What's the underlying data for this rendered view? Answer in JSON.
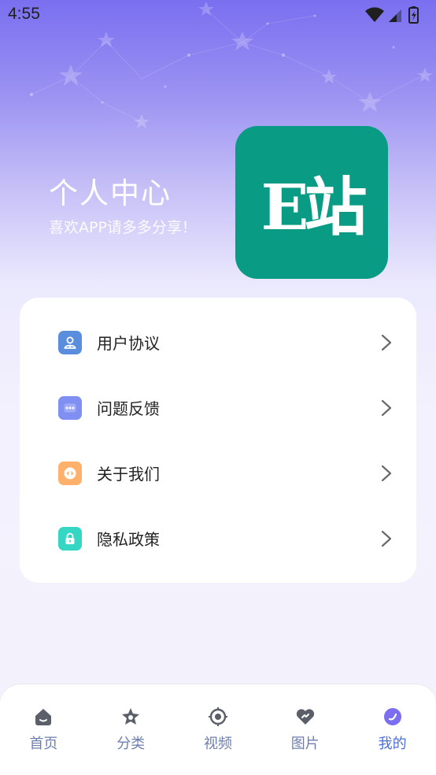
{
  "status_bar": {
    "time": "4:55"
  },
  "header": {
    "title": "个人中心",
    "subtitle": "喜欢APP请多多分享！",
    "logo_text": "E站",
    "logo_color": "#0a9b85"
  },
  "menu": {
    "items": [
      {
        "label": "用户协议",
        "icon": "user-agreement-icon",
        "color": "#5b8ddf"
      },
      {
        "label": "问题反馈",
        "icon": "feedback-chat-icon",
        "color": "#7f8ff2"
      },
      {
        "label": "关于我们",
        "icon": "about-us-icon",
        "color": "#ffb06a"
      },
      {
        "label": "隐私政策",
        "icon": "privacy-lock-icon",
        "color": "#35d6c4"
      }
    ]
  },
  "bottom_nav": {
    "items": [
      {
        "label": "首页",
        "icon": "home-icon"
      },
      {
        "label": "分类",
        "icon": "category-icon"
      },
      {
        "label": "视频",
        "icon": "video-icon"
      },
      {
        "label": "图片",
        "icon": "image-icon"
      },
      {
        "label": "我的",
        "icon": "profile-icon",
        "active": true
      }
    ],
    "active_color": "#4d6fd8",
    "inactive_color": "#6d7fb0"
  }
}
